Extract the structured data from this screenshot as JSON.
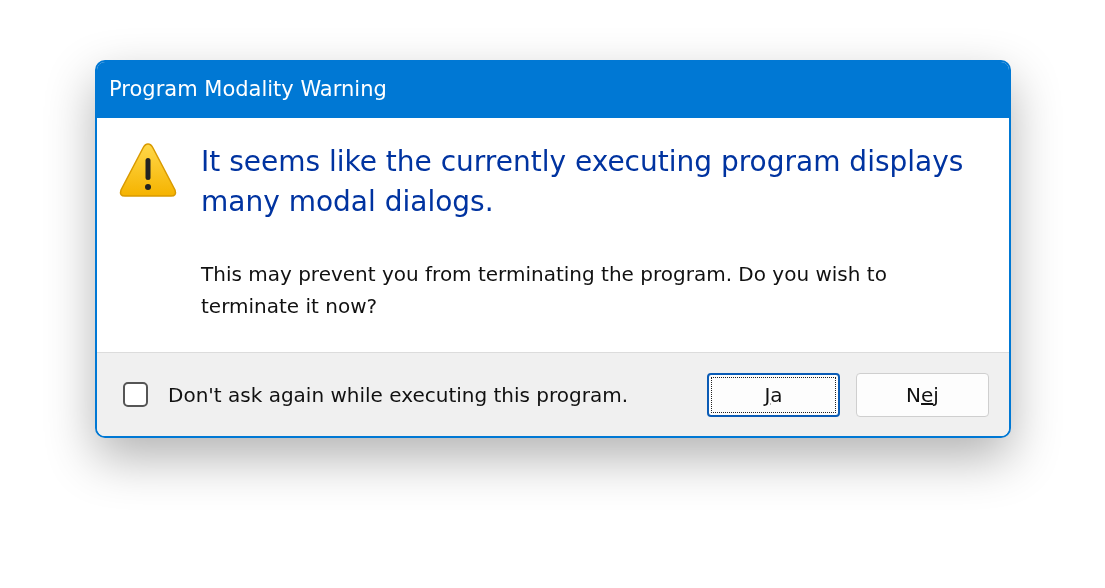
{
  "window": {
    "title": "Program Modality Warning"
  },
  "heading": "It seems like the currently executing program displays many modal dialogs.",
  "message": "This may prevent you from terminating the program. Do you wish to terminate it now?",
  "dont_ask": {
    "label": "Don't ask again while executing this program.",
    "checked": false
  },
  "buttons": [
    {
      "key": "J",
      "after": "a",
      "default": true
    },
    {
      "before": "N",
      "key": "e",
      "after": "j",
      "default": false
    }
  ]
}
